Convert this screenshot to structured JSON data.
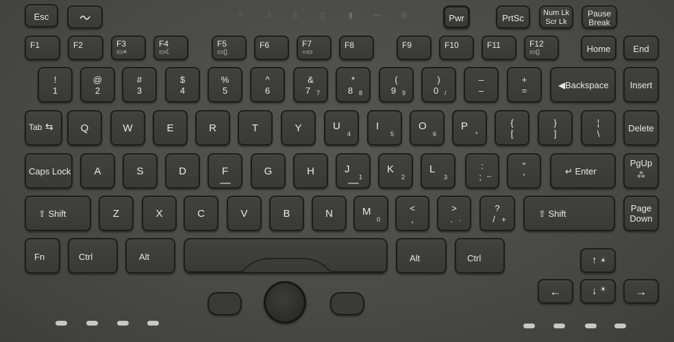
{
  "indicators": [
    {
      "name": "wireless-indicator-icon",
      "glyph": "⫯"
    },
    {
      "name": "warning-indicator-icon",
      "glyph": "⚠"
    },
    {
      "name": "warning-indicator-2-icon",
      "glyph": "⚠"
    },
    {
      "name": "drive-indicator-icon",
      "glyph": "▯"
    },
    {
      "name": "temperature-indicator-icon",
      "glyph": "▮"
    },
    {
      "name": "power-plug-indicator-icon",
      "glyph": "⊸"
    },
    {
      "name": "power-cycle-indicator-icon",
      "glyph": "⊘"
    }
  ],
  "top_row": {
    "esc": "Esc",
    "pwr": "Pwr",
    "prtsc": "PrtSc",
    "numlk_1": "Num Lk",
    "numlk_2": "Scr Lk",
    "pause_1": "Pause",
    "pause_2": "Break"
  },
  "function_row": {
    "f1": "F1",
    "f2": "F2",
    "f3": "F3",
    "f4": "F4",
    "f5": "F5",
    "f6": "F6",
    "f7": "F7",
    "f8": "F8",
    "f9": "F9",
    "f10": "F10",
    "f11": "F11",
    "f12": "F12",
    "home": "Home",
    "end": "End"
  },
  "number_row": [
    {
      "top": "!",
      "bottom": "1"
    },
    {
      "top": "@",
      "bottom": "2"
    },
    {
      "top": "#",
      "bottom": "3"
    },
    {
      "top": "$",
      "bottom": "4"
    },
    {
      "top": "%",
      "bottom": "5"
    },
    {
      "top": "^",
      "bottom": "6"
    },
    {
      "top": "&",
      "bottom": "7",
      "sub": "7"
    },
    {
      "top": "*",
      "bottom": "8",
      "sub": "8"
    },
    {
      "top": "(",
      "bottom": "9",
      "sub": "9"
    },
    {
      "top": ")",
      "bottom": "0",
      "sub": "/"
    },
    {
      "top": "–",
      "bottom": "–"
    },
    {
      "top": "+",
      "bottom": "="
    }
  ],
  "backspace": "Backspace",
  "insert": "Insert",
  "tab": "Tab",
  "qwerty_row": [
    {
      "label": "Q"
    },
    {
      "label": "W"
    },
    {
      "label": "E"
    },
    {
      "label": "R"
    },
    {
      "label": "T"
    },
    {
      "label": "Y"
    },
    {
      "label": "U",
      "sub": "4"
    },
    {
      "label": "I",
      "sub": "5"
    },
    {
      "label": "O",
      "sub": "6"
    },
    {
      "label": "P",
      "sub": "*"
    }
  ],
  "brackets": [
    {
      "top": "{",
      "bottom": "["
    },
    {
      "top": "}",
      "bottom": "]"
    },
    {
      "top": "¦",
      "bottom": "\\"
    }
  ],
  "delete": "Delete",
  "capslock": "Caps Lock",
  "home_row": [
    {
      "label": "A"
    },
    {
      "label": "S"
    },
    {
      "label": "D"
    },
    {
      "label": "F",
      "bump": true
    },
    {
      "label": "G"
    },
    {
      "label": "H"
    },
    {
      "label": "J",
      "sub": "1",
      "bump": true
    },
    {
      "label": "K",
      "sub": "2"
    },
    {
      "label": "L",
      "sub": "3"
    }
  ],
  "colon": {
    "top": ":",
    "bottom": ";",
    "sub": "–"
  },
  "quote": {
    "top": "\"",
    "bottom": "'"
  },
  "enter": "Enter",
  "pgup": "PgUp",
  "shift": "Shift",
  "bottom_row": [
    {
      "label": "Z"
    },
    {
      "label": "X"
    },
    {
      "label": "C"
    },
    {
      "label": "V"
    },
    {
      "label": "B"
    },
    {
      "label": "N"
    },
    {
      "label": "M",
      "sub": "0"
    }
  ],
  "comma": {
    "top": "<",
    "bottom": ",",
    "sub": "."
  },
  "period": {
    "top": ">",
    "bottom": ".",
    "sub": "."
  },
  "slash": {
    "top": "?",
    "bottom": "/",
    "sub": "+"
  },
  "pagedown_1": "Page",
  "pagedown_2": "Down",
  "space_row": {
    "fn": "Fn",
    "ctrl": "Ctrl",
    "alt": "Alt",
    "alt_r": "Alt",
    "ctrl_r": "Ctrl"
  },
  "arrows": {
    "up": "↑",
    "down": "↓",
    "left": "←",
    "right": "→",
    "brightness_up": "☀",
    "brightness_down": "☀"
  },
  "colors": {
    "key": "#3d3d3c",
    "key_border": "#1c1c1b",
    "legend": "#e9e9e6",
    "panel": "#4a4a48",
    "led": "#c9c9c4"
  }
}
